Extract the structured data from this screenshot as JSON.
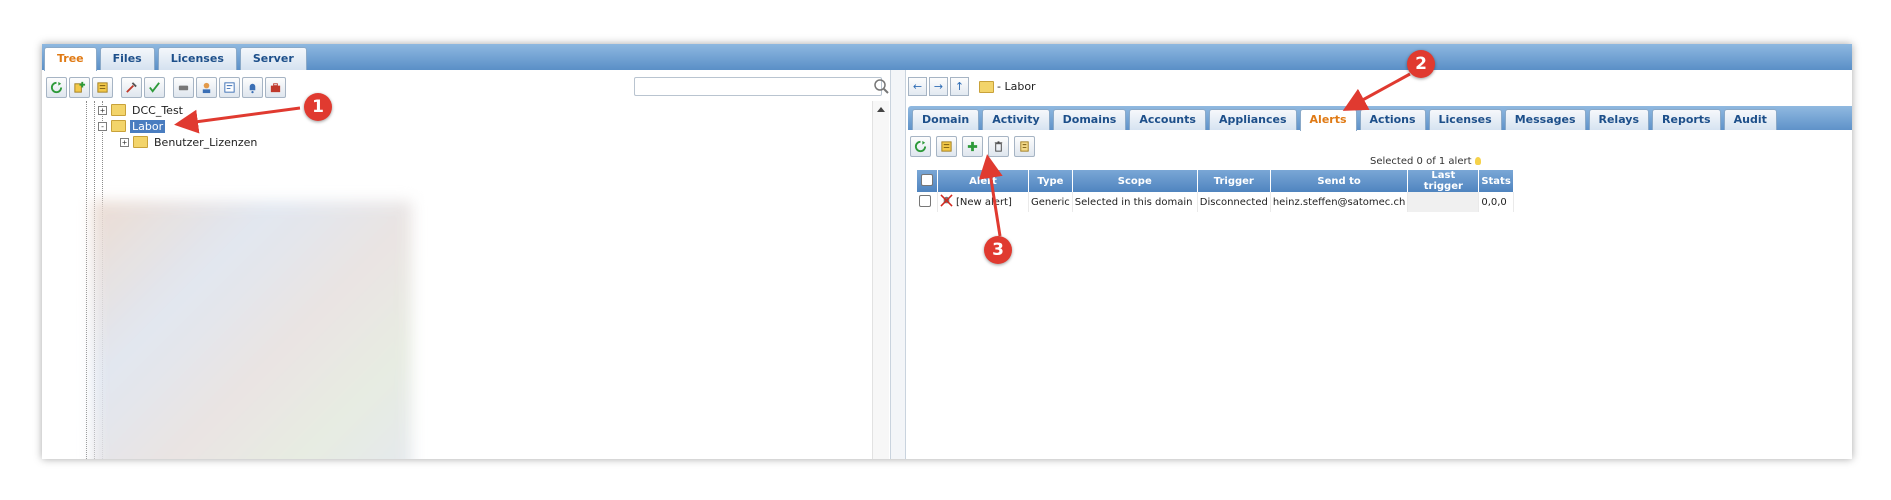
{
  "main_tabs": [
    {
      "label": "Tree",
      "active": true
    },
    {
      "label": "Files",
      "active": false
    },
    {
      "label": "Licenses",
      "active": false
    },
    {
      "label": "Server",
      "active": false
    }
  ],
  "search": {
    "placeholder": "",
    "value": ""
  },
  "tree": {
    "nodes": [
      {
        "label": "DCC_Test",
        "expander": "+",
        "selected": false
      },
      {
        "label": "Labor",
        "expander": "-",
        "selected": true
      },
      {
        "label": "Benutzer_Lizenzen",
        "expander": "+",
        "selected": false
      }
    ]
  },
  "breadcrumb": {
    "label": "- Labor"
  },
  "right_tabs": [
    {
      "label": "Domain",
      "active": false
    },
    {
      "label": "Activity",
      "active": false
    },
    {
      "label": "Domains",
      "active": false
    },
    {
      "label": "Accounts",
      "active": false
    },
    {
      "label": "Appliances",
      "active": false
    },
    {
      "label": "Alerts",
      "active": true
    },
    {
      "label": "Actions",
      "active": false
    },
    {
      "label": "Licenses",
      "active": false
    },
    {
      "label": "Messages",
      "active": false
    },
    {
      "label": "Relays",
      "active": false
    },
    {
      "label": "Reports",
      "active": false
    },
    {
      "label": "Audit",
      "active": false
    }
  ],
  "alerts": {
    "selected_info": "Selected 0 of 1 alert",
    "columns": [
      "Alert",
      "Type",
      "Scope",
      "Trigger",
      "Send to",
      "Last trigger",
      "Stats"
    ],
    "rows": [
      {
        "alert": "[New alert]",
        "type": "Generic",
        "scope": "Selected in this domain",
        "trigger": "Disconnected",
        "send_to": "heinz.steffen@satomec.ch",
        "last_trigger": "",
        "stats": "0,0,0"
      }
    ]
  },
  "callouts": [
    "1",
    "2",
    "3"
  ],
  "colors": {
    "accent": "#e07a14",
    "tab_blue": "#1d4f8a",
    "callout_red": "#e03a30",
    "header_blue": "#5a8fc7"
  }
}
